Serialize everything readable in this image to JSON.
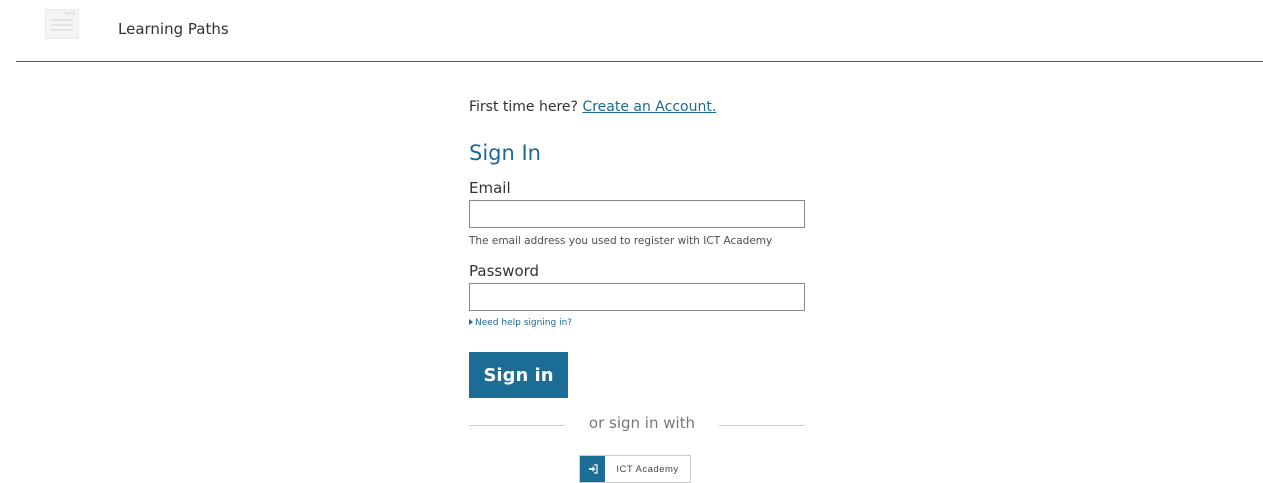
{
  "header": {
    "brand": "Learning Paths",
    "logo_icon": "document-logo-icon",
    "border_color": "#1f6996"
  },
  "signin": {
    "first_time_text": "First time here?",
    "create_account_link": "Create an Account.",
    "title": "Sign In",
    "email_label": "Email",
    "email_value": "",
    "email_hint": "The email address you used to register with ICT Academy",
    "password_label": "Password",
    "password_value": "",
    "help_link": "Need help signing in?",
    "submit_label": "Sign in",
    "alt_divider": "or sign in with",
    "provider_label": "ICT Academy",
    "provider_icon": "sign-in-icon",
    "accent_color": "#1c6d96"
  }
}
